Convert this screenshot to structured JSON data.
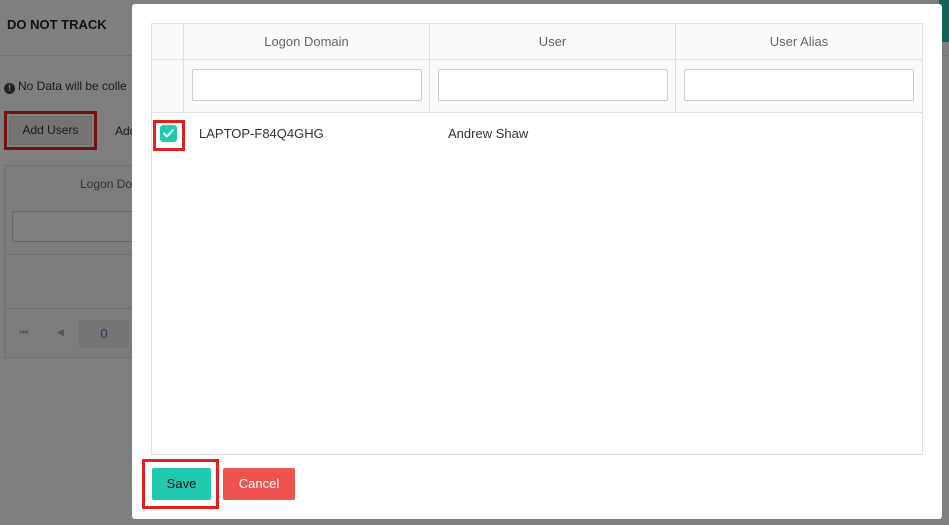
{
  "background": {
    "title": "DO NOT TRACK",
    "notice_icon": "exclamation-circle-icon",
    "notice_text": "No Data will be colle",
    "add_users_label": "Add Users",
    "add_other_label": "Add",
    "table": {
      "column_header": "Logon Do",
      "pager_page": "0"
    }
  },
  "modal": {
    "columns": [
      "Logon Domain",
      "User",
      "User Alias"
    ],
    "rows": [
      {
        "checked": true,
        "logon_domain": "LAPTOP-F84Q4GHG",
        "user": "Andrew Shaw",
        "user_alias": ""
      }
    ],
    "save_label": "Save",
    "cancel_label": "Cancel"
  },
  "colors": {
    "accent": "#20c9b0",
    "danger": "#ef5350",
    "highlight": "#e02121"
  }
}
